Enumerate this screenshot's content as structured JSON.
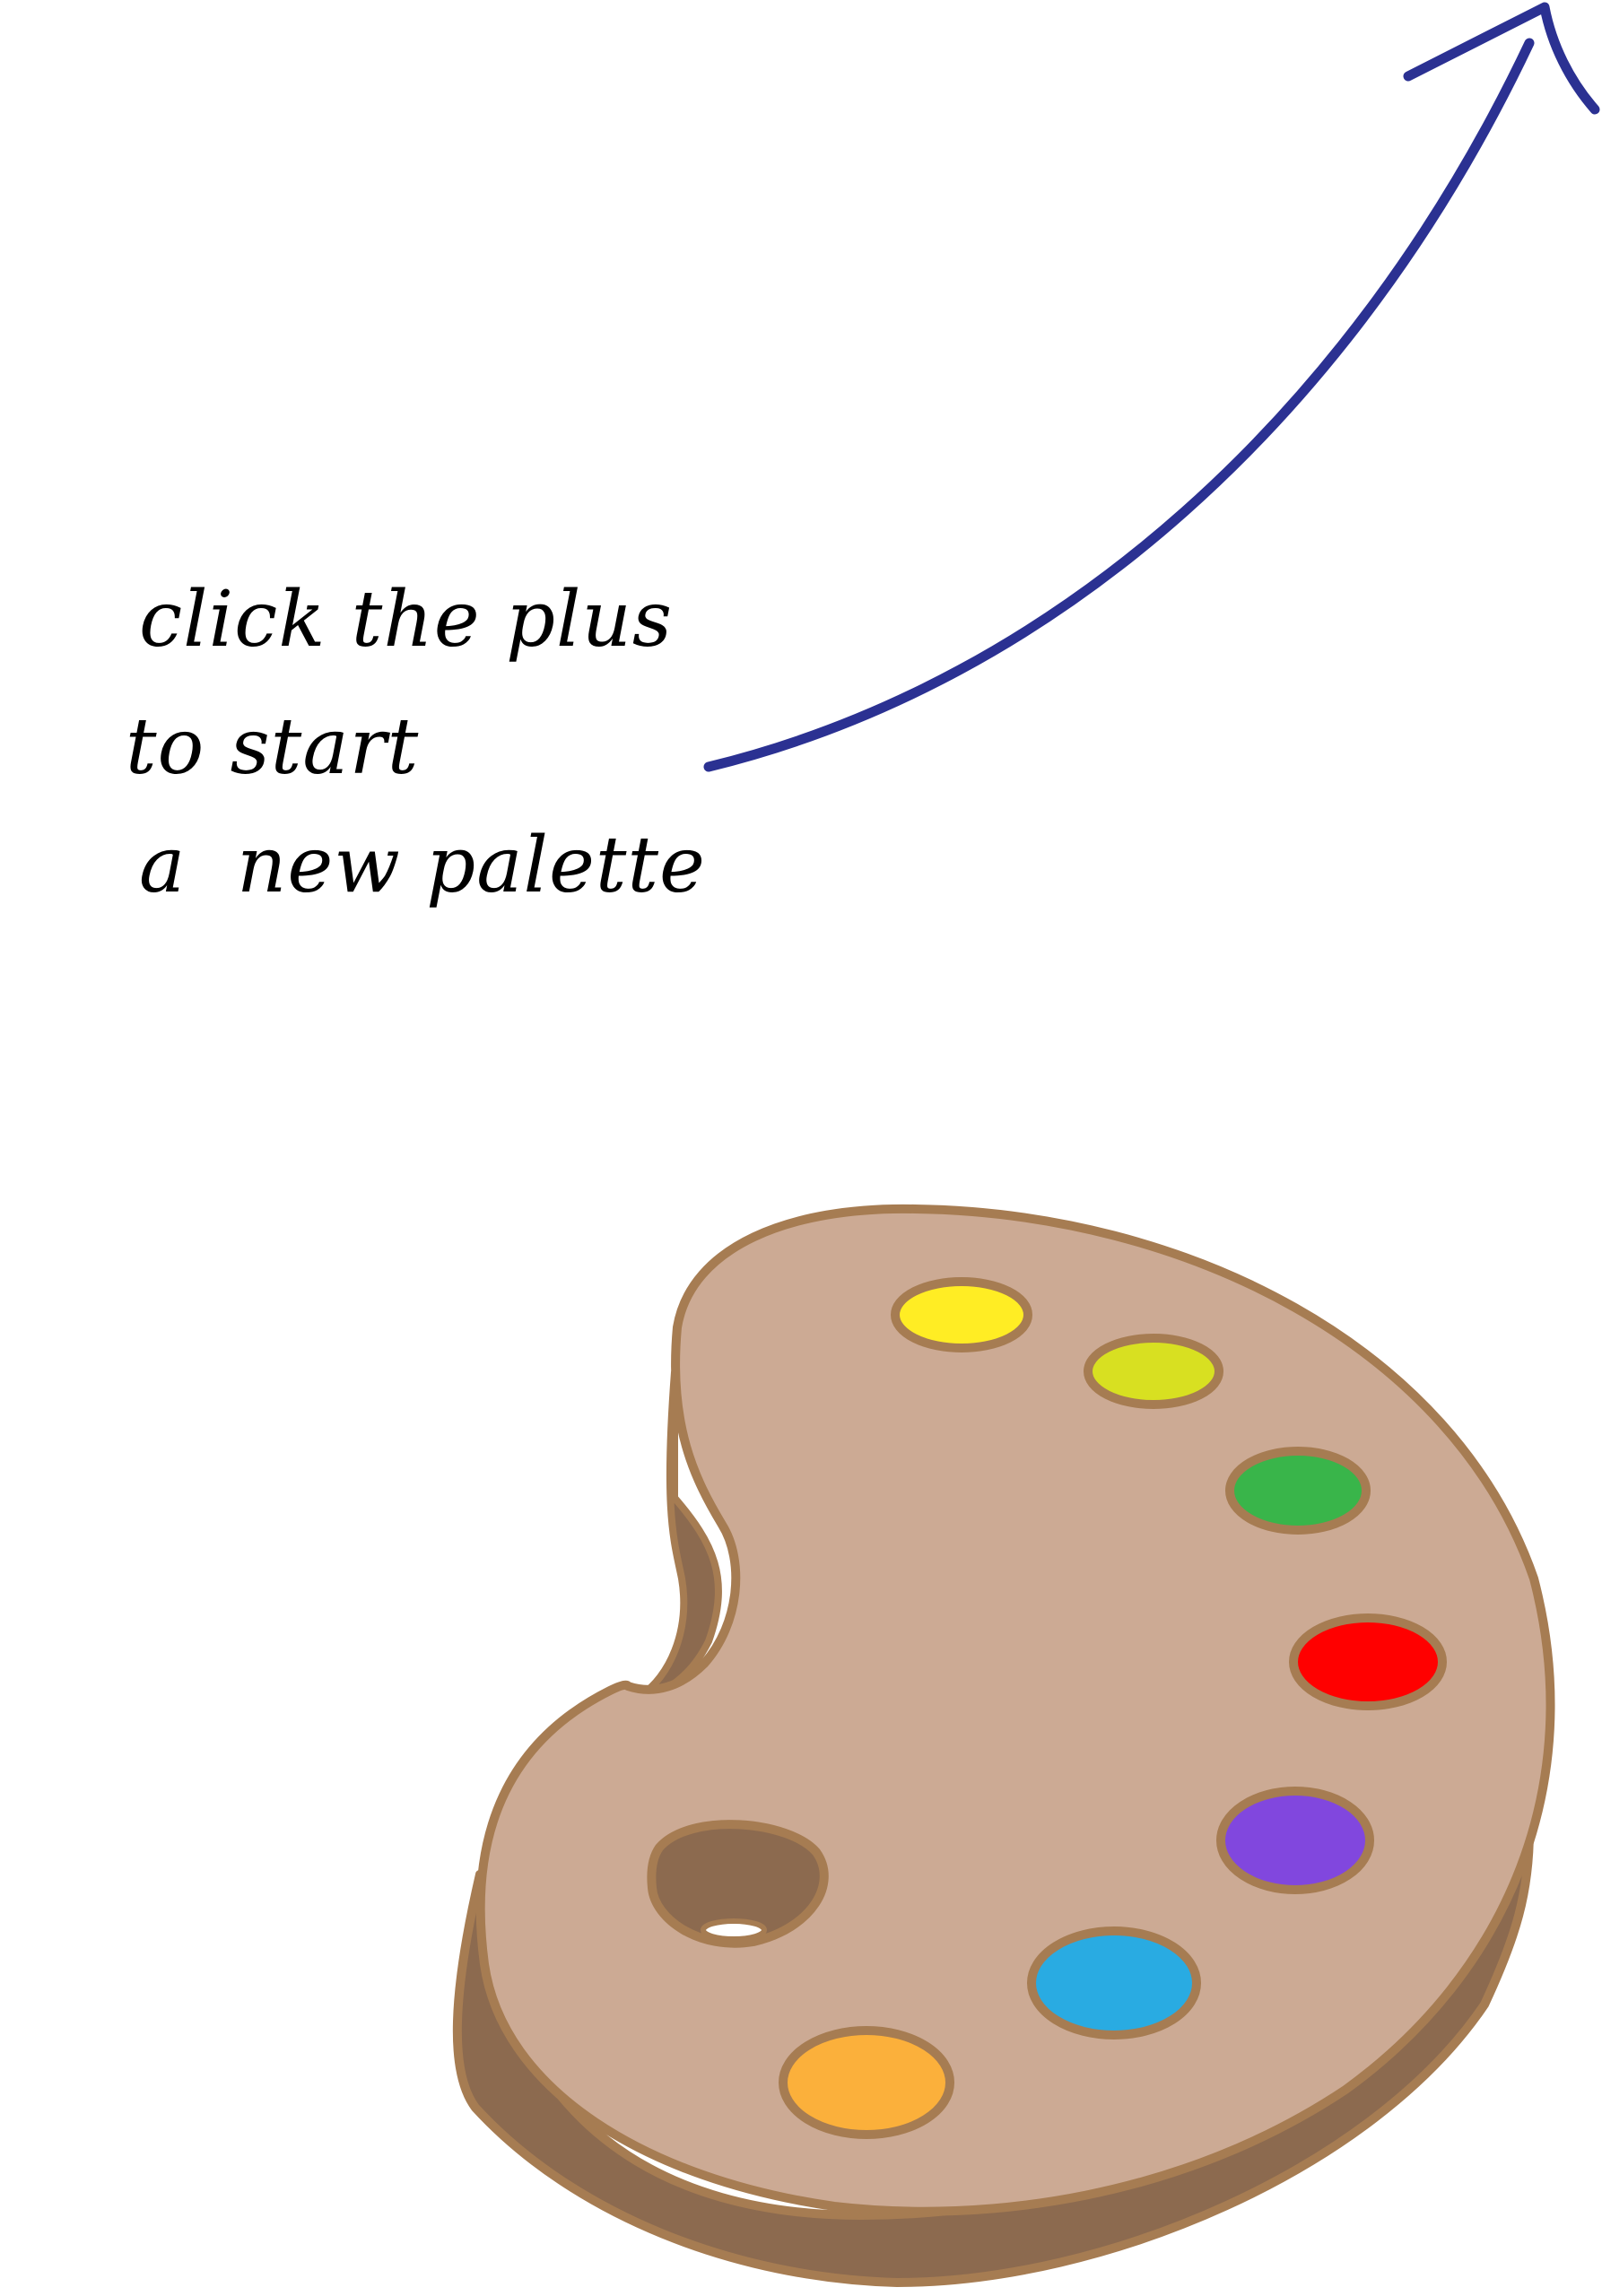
{
  "hint": {
    "lines": [
      "click the plus",
      "to start",
      "a  new palette"
    ]
  },
  "colors": {
    "arrow": "#2B3192",
    "palette_fill": "#CCAA94",
    "palette_edge": "#A67C52",
    "palette_side": "#8C6A4F",
    "paints": {
      "yellow": "#FFED24",
      "lime": "#D8E021",
      "green": "#39B54A",
      "red": "#FF0000",
      "purple": "#8147DE",
      "blue": "#29ABE2",
      "orange": "#FBB03B"
    }
  },
  "icons": {
    "arrow": "curved-arrow-icon",
    "palette": "paint-palette-icon"
  }
}
